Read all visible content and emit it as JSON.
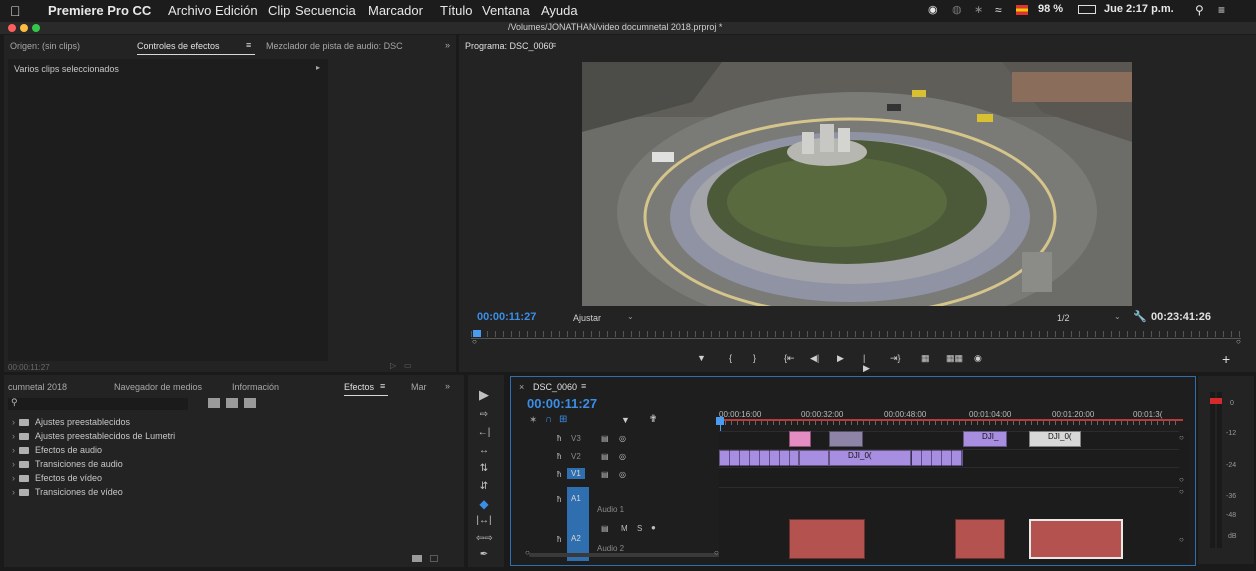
{
  "menubar": {
    "app_name": "Premiere Pro CC",
    "menus": [
      "Archivo",
      "Edición",
      "Clip",
      "Secuencia",
      "Marcador",
      "Título",
      "Ventana",
      "Ayuda"
    ],
    "battery": "98 %",
    "clock": "Jue 2:17 p.m."
  },
  "window": {
    "title": "/Volumes/JONATHAN/video documnetal 2018.prproj *"
  },
  "source_panel": {
    "tabs": [
      "Origen: (sin clips)",
      "Controles de efectos",
      "Mezclador de pista de audio: DSC"
    ],
    "active_tab_index": 1,
    "selection_label": "Varios clips seleccionados",
    "timecode": "00:00:11:27"
  },
  "program_panel": {
    "title": "Programa: DSC_0060",
    "timecode": "00:00:11:27",
    "fit": "Ajustar",
    "resolution": "1/2",
    "duration": "00:23:41:26"
  },
  "project_panel": {
    "tabs": [
      "cumnetal 2018",
      "Navegador de medios",
      "Información",
      "Efectos",
      "Mar"
    ],
    "active_tab_index": 3,
    "items": [
      "Ajustes preestablecidos",
      "Ajustes preestablecidos de Lumetri",
      "Efectos de audio",
      "Transiciones de audio",
      "Efectos de vídeo",
      "Transiciones de vídeo"
    ]
  },
  "timeline": {
    "sequence": "DSC_0060",
    "timecode": "00:00:11:27",
    "ruler": [
      "00:00:16:00",
      "00:00:32:00",
      "00:00:48:00",
      "00:01:04:00",
      "00:01:20:00",
      "00:01:3("
    ],
    "tracks": {
      "v3": "V3",
      "v2": "V2",
      "v1": "V1",
      "a1": "A1",
      "a1_name": "Audio 1",
      "a2": "A2",
      "a2_name": "Audio 2",
      "mute": "M",
      "solo": "S"
    },
    "clip_labels": {
      "dji_v3_a": "DJI_",
      "dji_v3_b": "DJI_0(",
      "dji_v2": "DJI_0("
    }
  },
  "audio_meter": {
    "scale": [
      "0",
      "-12",
      "-24",
      "-36",
      "-48",
      "dB"
    ]
  },
  "colors": {
    "accent_blue": "#3a8ee6",
    "clip_purple": "#a88ee0",
    "clip_audio": "#b3524f",
    "track_blue": "#2f6fb0",
    "playhead": "#4a9cf0"
  }
}
